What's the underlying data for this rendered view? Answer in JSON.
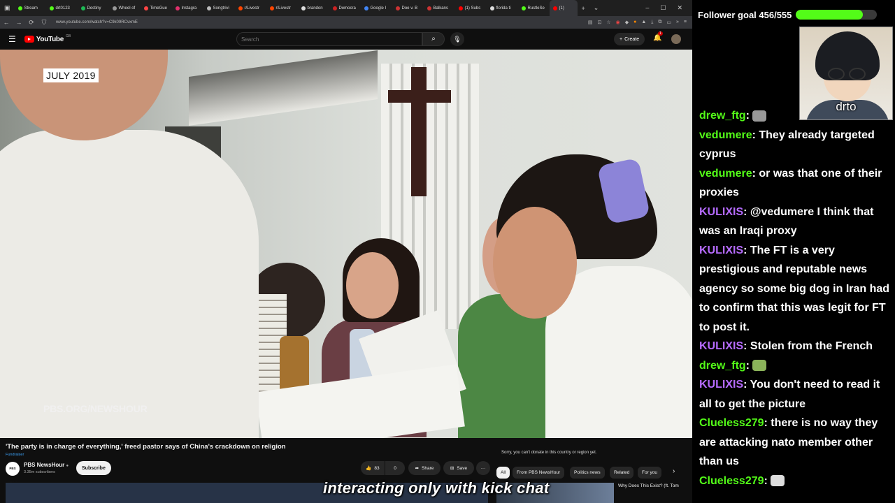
{
  "browser": {
    "tabs": [
      {
        "label": "Stream",
        "color": "#53fc18"
      },
      {
        "label": "drt0123",
        "color": "#53fc18"
      },
      {
        "label": "Destiny",
        "color": "#1db954"
      },
      {
        "label": "Wheel of",
        "color": "#999999"
      },
      {
        "label": "TimeGue",
        "color": "#ff4444"
      },
      {
        "label": "Instagra",
        "color": "#e1306c"
      },
      {
        "label": "Songtrivi",
        "color": "#bbbbbb"
      },
      {
        "label": "r/Livestr",
        "color": "#ff4500"
      },
      {
        "label": "r/Livestr",
        "color": "#ff4500"
      },
      {
        "label": "brandon",
        "color": "#dddddd"
      },
      {
        "label": "Democra",
        "color": "#cc2222"
      },
      {
        "label": "Google I",
        "color": "#4285f4"
      },
      {
        "label": "Doe v. B",
        "color": "#cc3333"
      },
      {
        "label": "Balkans",
        "color": "#cc3333"
      },
      {
        "label": "(1) Subs",
        "color": "#ff0000"
      },
      {
        "label": "florida ti",
        "color": "#dddddd"
      },
      {
        "label": "RustleSe",
        "color": "#53fc18"
      },
      {
        "label": "(1)",
        "color": "#ff0000"
      }
    ],
    "url": "www.youtube.com/watch?v=C9k09RCvxmE"
  },
  "youtube": {
    "logo_text": "YouTube",
    "logo_country": "GB",
    "search_placeholder": "Search",
    "create_label": "Create",
    "notif_count": "1"
  },
  "video": {
    "date_overlay": "JULY 2019",
    "watermark": "PBS.ORG/NEWSHOUR",
    "title": "'The party is in charge of everything,' freed pastor says of China's crackdown on religion",
    "fundraiser_label": "Fundraiser",
    "donate_message": "Sorry, you can't donate in this country or region yet.",
    "channel_name": "PBS NewsHour",
    "channel_avatar_text": "PBS NEWS",
    "subscribers": "3.35m subscribers",
    "subscribe_label": "Subscribe",
    "likes": "83",
    "dislikes": "0",
    "share_label": "Share",
    "save_label": "Save",
    "more_label": "···"
  },
  "chips": [
    "All",
    "From PBS NewsHour",
    "Politics news",
    "Related",
    "For you"
  ],
  "recommendation_title": "Why Does This Exist? (ft. Tom",
  "caption": "interacting only with kick chat",
  "stream": {
    "goal_label": "Follower goal 456/555",
    "goal_progress": 0.8216,
    "cam_name": "drto"
  },
  "chat": [
    {
      "user": "drew_ftg",
      "color": "#53fc18",
      "text": "",
      "emote": "#999999"
    },
    {
      "user": "vedumere",
      "color": "#53fc18",
      "text": "They already targeted cyprus"
    },
    {
      "user": "vedumere",
      "color": "#53fc18",
      "text": "or was that one of their proxies"
    },
    {
      "user": "KULIXIS",
      "color": "#b66bff",
      "text": "@vedumere I think that was an Iraqi proxy"
    },
    {
      "user": "KULIXIS",
      "color": "#b66bff",
      "text": "The FT is a very prestigious and reputable news agency so some big dog in Iran had to confirm that this was legit for FT to post it."
    },
    {
      "user": "KULIXIS",
      "color": "#b66bff",
      "text": "Stolen from the French"
    },
    {
      "user": "drew_ftg",
      "color": "#53fc18",
      "text": "",
      "emote": "#8bb35a"
    },
    {
      "user": "KULIXIS",
      "color": "#b66bff",
      "text": "You don't need to read it all to get the picture"
    },
    {
      "user": "Clueless279",
      "color": "#53fc18",
      "text": "there is no way they are attacking nato member other than us"
    },
    {
      "user": "Clueless279",
      "color": "#53fc18",
      "text": "",
      "emote": "#dddddd"
    }
  ]
}
